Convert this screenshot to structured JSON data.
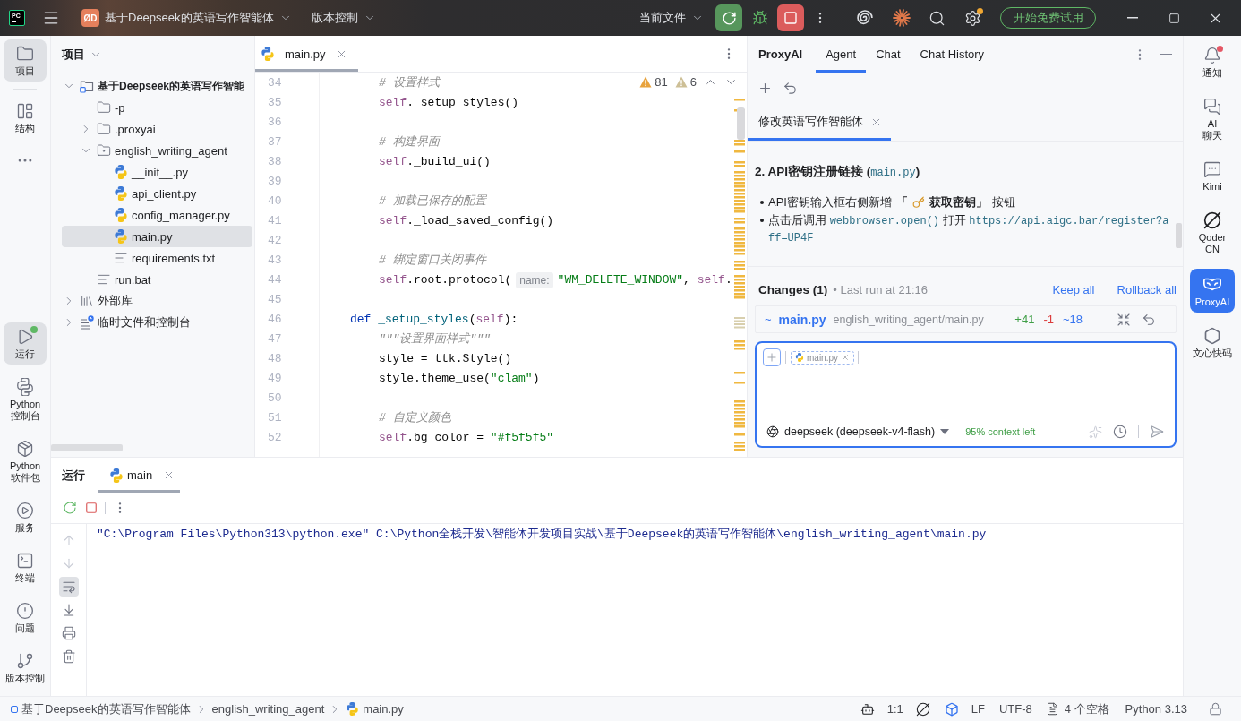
{
  "title_bar": {
    "logo": "PC",
    "project_badge": "ØD",
    "project": "基于Deepseek的英语写作智能体",
    "vcs": "版本控制",
    "run_config": "当前文件",
    "settings_update": true,
    "trial_button": "开始免费试用"
  },
  "left_strip": {
    "top": [
      {
        "label": "项目",
        "kind": "folder",
        "selected": true,
        "badge": false
      },
      {
        "label": "结构",
        "kind": "structure",
        "selected": false,
        "badge": false
      }
    ],
    "bottom": [
      {
        "label": "运行",
        "kind": "run",
        "selected": true,
        "badge": true
      },
      {
        "label": "Python 控制台",
        "kind": "python-console",
        "selected": false,
        "badge": false
      },
      {
        "label": "Python 软件包",
        "kind": "packages",
        "selected": false,
        "badge": false
      },
      {
        "label": "服务",
        "kind": "services",
        "selected": false,
        "badge": false
      },
      {
        "label": "终端",
        "kind": "terminal",
        "selected": false,
        "badge": false
      },
      {
        "label": "问题",
        "kind": "problems",
        "selected": false,
        "badge": false
      },
      {
        "label": "版本控制",
        "kind": "vcs",
        "selected": false,
        "badge": false
      }
    ]
  },
  "project_panel": {
    "title": "项目",
    "tree": [
      {
        "label": "基于Deepseek的英语写作智能",
        "kind": "project",
        "expanded": true,
        "selected": false,
        "children": [
          {
            "label": "-p",
            "kind": "folder",
            "selected": false
          },
          {
            "label": ".proxyai",
            "kind": "folder",
            "expanded": false,
            "selected": false
          },
          {
            "label": "english_writing_agent",
            "kind": "package",
            "expanded": true,
            "selected": false,
            "children": [
              {
                "label": "__init__.py",
                "kind": "python",
                "selected": false
              },
              {
                "label": "api_client.py",
                "kind": "python",
                "selected": false
              },
              {
                "label": "config_manager.py",
                "kind": "python",
                "selected": false
              },
              {
                "label": "main.py",
                "kind": "python",
                "selected": true
              },
              {
                "label": "requirements.txt",
                "kind": "text",
                "selected": false
              }
            ]
          },
          {
            "label": "run.bat",
            "kind": "text",
            "selected": false
          }
        ]
      },
      {
        "label": "外部库",
        "kind": "library",
        "expanded": false,
        "selected": false
      },
      {
        "label": "临时文件和控制台",
        "kind": "scratches",
        "expanded": false,
        "selected": false
      }
    ]
  },
  "editor": {
    "tab": {
      "label": "main.py",
      "selected": true
    },
    "inspections": [
      {
        "kind": "warning",
        "count": "81"
      },
      {
        "kind": "weak-warning",
        "count": "6"
      }
    ],
    "lines": [
      {
        "number": "34",
        "kind": "body",
        "tokens": [
          {
            "kind": "comment",
            "text": "# 设置样式"
          }
        ]
      },
      {
        "number": "35",
        "kind": "body",
        "tokens": [
          {
            "kind": "self",
            "text": "self"
          },
          {
            "kind": "plain",
            "text": "._setup_styles()"
          }
        ]
      },
      {
        "number": "36"
      },
      {
        "number": "37",
        "kind": "body",
        "tokens": [
          {
            "kind": "comment",
            "text": "# 构建界面"
          }
        ]
      },
      {
        "number": "38",
        "kind": "body",
        "tokens": [
          {
            "kind": "self",
            "text": "self"
          },
          {
            "kind": "plain",
            "text": "._build_ui()"
          }
        ]
      },
      {
        "number": "39"
      },
      {
        "number": "40",
        "kind": "body",
        "tokens": [
          {
            "kind": "comment",
            "text": "# 加载已保存的配置"
          }
        ]
      },
      {
        "number": "41",
        "kind": "body",
        "tokens": [
          {
            "kind": "self",
            "text": "self"
          },
          {
            "kind": "plain",
            "text": "._load_saved_config()"
          }
        ]
      },
      {
        "number": "42"
      },
      {
        "number": "43",
        "kind": "body",
        "tokens": [
          {
            "kind": "comment",
            "text": "# 绑定窗口关闭事件"
          }
        ]
      },
      {
        "number": "44",
        "kind": "body",
        "tokens": [
          {
            "kind": "self",
            "text": "self"
          },
          {
            "kind": "plain",
            "text": ".root.protocol("
          },
          {
            "kind": "hint",
            "text": "name:"
          },
          {
            "kind": "string",
            "text": "\"WM_DELETE_WINDOW\""
          },
          {
            "kind": "plain",
            "text": ", "
          },
          {
            "kind": "self",
            "text": "self"
          },
          {
            "kind": "plain",
            "text": "."
          }
        ]
      },
      {
        "number": "45"
      },
      {
        "number": "46",
        "kind": "def",
        "tokens": [
          {
            "kind": "keyword",
            "text": "def "
          },
          {
            "kind": "function",
            "text": "_setup_styles"
          },
          {
            "kind": "plain",
            "text": "("
          },
          {
            "kind": "self",
            "text": "self"
          },
          {
            "kind": "plain",
            "text": "):"
          }
        ]
      },
      {
        "number": "47",
        "kind": "body",
        "tokens": [
          {
            "kind": "docstring",
            "text": "\"\"\"设置界面样式\"\"\""
          }
        ]
      },
      {
        "number": "48",
        "kind": "body",
        "tokens": [
          {
            "kind": "plain",
            "text": "style = ttk.Style()"
          }
        ]
      },
      {
        "number": "49",
        "kind": "body",
        "tokens": [
          {
            "kind": "plain",
            "text": "style.theme_use("
          },
          {
            "kind": "string",
            "text": "\"clam\""
          },
          {
            "kind": "plain",
            "text": ")"
          }
        ]
      },
      {
        "number": "50"
      },
      {
        "number": "51",
        "kind": "body",
        "tokens": [
          {
            "kind": "comment",
            "text": "# 自定义颜色"
          }
        ]
      },
      {
        "number": "52",
        "kind": "body",
        "tokens": [
          {
            "kind": "self",
            "text": "self"
          },
          {
            "kind": "plain",
            "text": ".bg_color = "
          },
          {
            "kind": "string",
            "text": "\"#f5f5f5\""
          }
        ]
      }
    ]
  },
  "chat": {
    "brand": "ProxyAI",
    "tabs": [
      {
        "label": "Agent",
        "selected": true
      },
      {
        "label": "Chat",
        "selected": false
      },
      {
        "label": "Chat History",
        "selected": false
      }
    ],
    "session_tab": {
      "label": "修改英语写作智能体",
      "selected": true
    },
    "message": {
      "heading": [
        {
          "kind": "text",
          "text": "2. API密钥注册链接 ("
        },
        {
          "kind": "code",
          "text": "main.py"
        },
        {
          "kind": "text",
          "text": ")"
        }
      ],
      "bullets": [
        {
          "segments": [
            {
              "kind": "text",
              "text": "API密钥输入框右侧新增"
            },
            {
              "kind": "bold",
              "text": "「"
            },
            {
              "kind": "key"
            },
            {
              "kind": "bold",
              "text": "获取密钥」"
            },
            {
              "kind": "text",
              "text": "按钮"
            }
          ]
        },
        {
          "segments": [
            {
              "kind": "text",
              "text": "点击后调用 "
            },
            {
              "kind": "code",
              "text": "webbrowser.open()"
            },
            {
              "kind": "text",
              "text": " 打开 "
            },
            {
              "kind": "code",
              "text": "https://api.aigc.bar/register?aff=UP4F"
            }
          ]
        }
      ]
    },
    "changes": {
      "title": "Changes (1)",
      "last_run": "• Last run at 21:16",
      "actions": [
        "Keep all",
        "Rollback all"
      ],
      "files": [
        {
          "status": "~",
          "name": "main.py",
          "path": "english_writing_agent/main.py",
          "added": "+41",
          "removed": "-1",
          "modified": "~18"
        }
      ]
    },
    "input": {
      "attachments": [
        "main.py"
      ],
      "model": "deepseek (deepseek-v4-flash)",
      "context": "95% context left"
    }
  },
  "right_strip": [
    {
      "label": "通知",
      "kind": "bell",
      "selected": false,
      "badge": true
    },
    {
      "label": "AI 聊天",
      "kind": "chat",
      "selected": false,
      "badge": false
    },
    {
      "label": "Kimi",
      "kind": "kimi",
      "selected": false,
      "badge": false
    },
    {
      "label": "Qoder CN",
      "kind": "qoder",
      "selected": false,
      "badge": false
    },
    {
      "label": "ProxyAI",
      "kind": "proxyai",
      "selected": true,
      "badge": false
    },
    {
      "label": "文心快码",
      "kind": "wenxin",
      "selected": false,
      "badge": false
    }
  ],
  "bottom_panel": {
    "title": "运行",
    "tabs": [
      {
        "label": "main",
        "selected": true
      }
    ],
    "tools": [
      {
        "kind": "up",
        "on": false,
        "disabled": true
      },
      {
        "kind": "down",
        "on": false,
        "disabled": true
      },
      {
        "kind": "wrap",
        "on": true,
        "disabled": false
      },
      {
        "kind": "scroll-end",
        "on": false,
        "disabled": false
      },
      {
        "kind": "print",
        "on": false,
        "disabled": false
      },
      {
        "kind": "clear",
        "on": false,
        "disabled": false
      }
    ],
    "console": [
      "\"C:\\Program Files\\Python313\\python.exe\" C:\\Python全栈开发\\智能体开发项目实战\\基于Deepseek的英语写作智能体\\english_writing_agent\\main.py"
    ]
  },
  "status_bar": {
    "breadcrumbs": [
      {
        "label": "基于Deepseek的英语写作智能体",
        "kind": "module"
      },
      {
        "label": "english_writing_agent",
        "kind": "folder"
      },
      {
        "label": "main.py",
        "kind": "python"
      }
    ],
    "position": "1:1",
    "line_separator": "LF",
    "encoding": "UTF-8",
    "indent": "4 个空格",
    "interpreter": "Python 3.13"
  }
}
